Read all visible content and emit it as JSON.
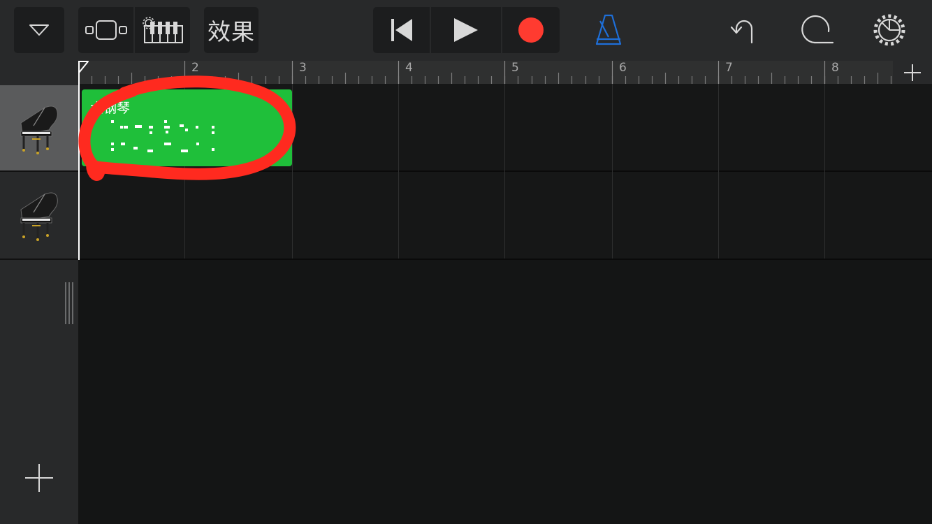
{
  "toolbar": {
    "browser_icon": "triangle-down-icon",
    "tracks_view_icon": "tracks-view-icon",
    "instrument_icon": "keyboard-settings-icon",
    "fx_label": "效果",
    "transport": {
      "rewind_icon": "go-to-beginning-icon",
      "play_icon": "play-icon",
      "record_icon": "record-icon"
    },
    "metronome_icon": "metronome-icon",
    "undo_icon": "undo-icon",
    "loop_icon": "loop-browser-icon",
    "settings_icon": "gear-icon"
  },
  "ruler": {
    "bars": [
      "2",
      "3",
      "4",
      "5",
      "6",
      "7",
      "8"
    ],
    "add_section_icon": "plus-icon"
  },
  "tracks": [
    {
      "instrument_icon": "grand-piano-icon",
      "selected": true
    },
    {
      "instrument_icon": "grand-piano-icon",
      "selected": false
    }
  ],
  "region": {
    "name": "大钢琴",
    "color": "#1fbf3a"
  },
  "sidebar": {
    "add_track_icon": "plus-icon"
  },
  "annotation": {
    "color": "#ff2a1f"
  },
  "colors": {
    "accent_blue": "#1e6fd9",
    "record_red": "#ff3b30"
  }
}
